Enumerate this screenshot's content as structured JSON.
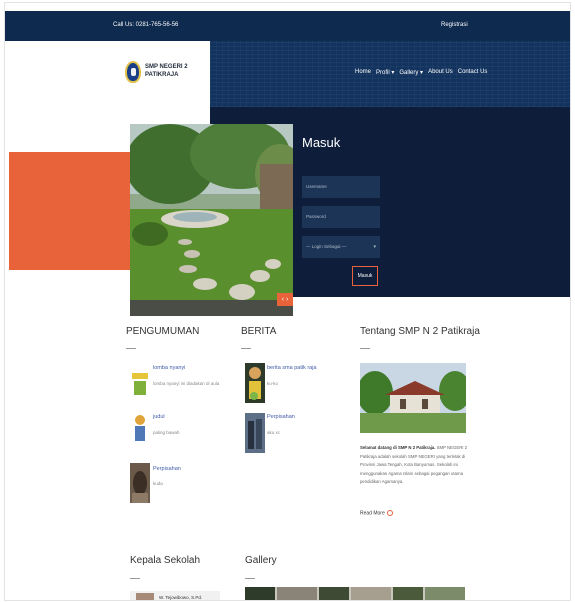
{
  "topbar": {
    "call": "Call Us: 0281-765-56-56",
    "register": "Registrasi"
  },
  "brand": {
    "name": "SMP NEGERI 2 PATIKRAJA"
  },
  "nav": [
    {
      "label": "Home"
    },
    {
      "label": "Profil ▾"
    },
    {
      "label": "Gallery ▾"
    },
    {
      "label": "About Us"
    },
    {
      "label": "Contact Us"
    }
  ],
  "login": {
    "title": "Masuk",
    "username_placeholder": "Username",
    "password_placeholder": "Password",
    "role_select": "— Login Sebagai —",
    "submit": "Masuk"
  },
  "slider": {
    "control": "‹ ›"
  },
  "pengumuman": {
    "title": "PENGUMUMAN",
    "items": [
      {
        "title": "lomba nyanyi",
        "desc": "lomba nyanyi ini diadakan di aula",
        "thumb": "trophy-image"
      },
      {
        "title": "judul",
        "desc": "paling bawah",
        "thumb": "student-image"
      },
      {
        "title": "Perpisahan",
        "desc": "kuda",
        "thumb": "horse-image"
      }
    ]
  },
  "berita": {
    "title": "BERITA",
    "items": [
      {
        "title": "berita sma patik raja",
        "desc": "ko-ko",
        "thumb": "news-image"
      },
      {
        "title": "Perpisahan",
        "desc": "aku xc",
        "thumb": "graduation-image"
      }
    ]
  },
  "tentang": {
    "title": "Tentang SMP N 2 Patikraja",
    "text_lead": "Selamat datang di SMP N 2 Patikraja.",
    "text_body": "SMP NEGERI 2 Patikraja adalah sekolah SMP NEGERI yang terletak di Provinsi Jawa Tengah, Kota Banyumas. Sekolah ini menggunakan Agama Islam sebagai pegangan utama pendidikan Agamanya.",
    "read_more": "Read More"
  },
  "kepala": {
    "title": "Kepala Sekolah",
    "name": "W. Tejowibowo, S.Pd."
  },
  "gallery": {
    "title": "Gallery"
  },
  "colors": {
    "navy": "#0e2a4e",
    "dark_panel": "#0d1d3a",
    "accent": "#e8623a",
    "link": "#3d5aa8"
  }
}
